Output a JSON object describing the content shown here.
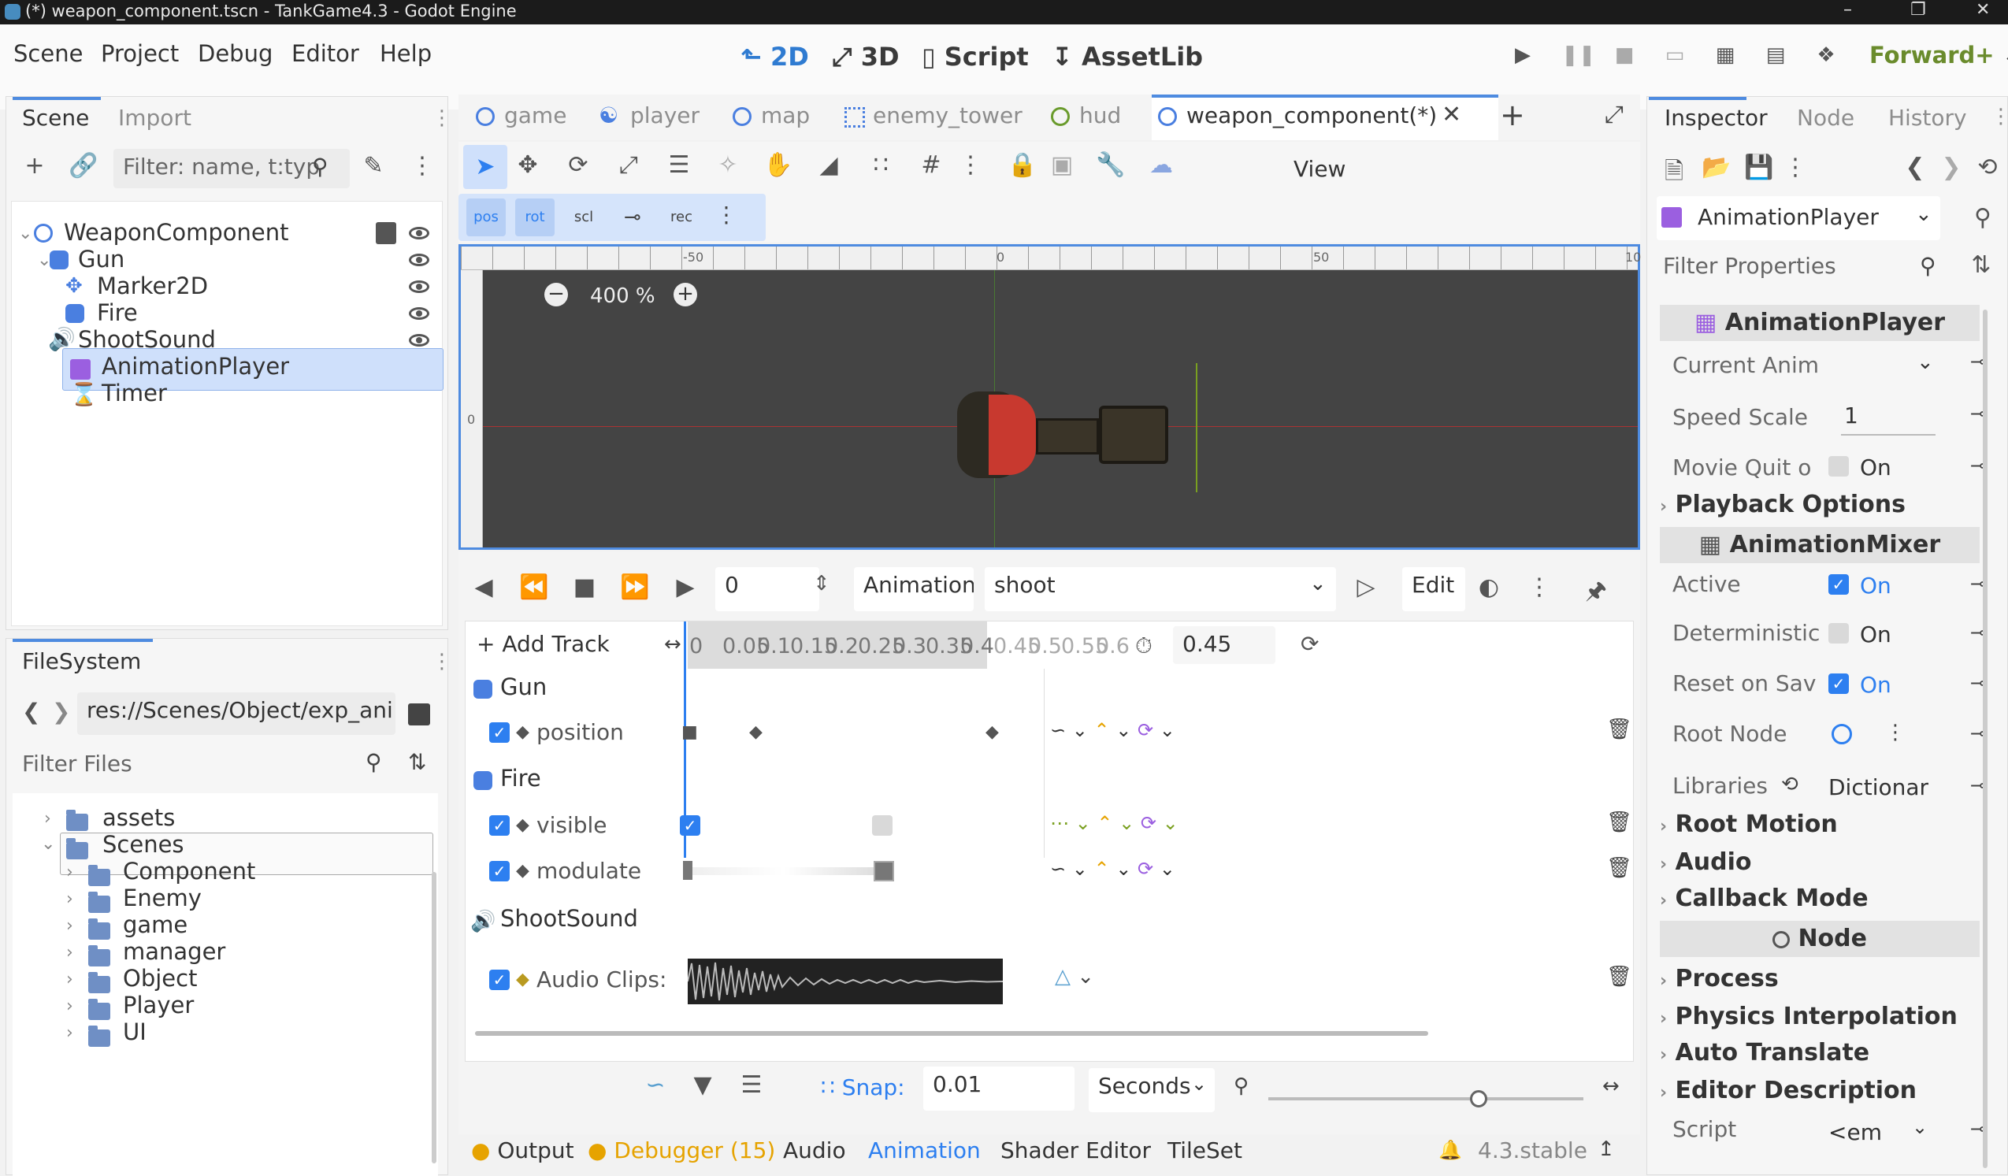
{
  "window": {
    "title": "(*) weapon_component.tscn - TankGame4.3 - Godot Engine"
  },
  "menu": [
    "Scene",
    "Project",
    "Debug",
    "Editor",
    "Help"
  ],
  "main_buttons": [
    "2D",
    "3D",
    "Script",
    "AssetLib"
  ],
  "renderer": "Forward+",
  "scene_dock": {
    "tabs": [
      "Scene",
      "Import"
    ],
    "filter_placeholder": "Filter: name, t:typ",
    "tree": [
      "WeaponComponent",
      "Gun",
      "Marker2D",
      "Fire",
      "ShootSound",
      "AnimationPlayer",
      "Timer"
    ]
  },
  "filesystem": {
    "tab": "FileSystem",
    "path": "res://Scenes/Object/exp_ani",
    "filter_placeholder": "Filter Files",
    "items": [
      "assets",
      "Scenes",
      "Component",
      "Enemy",
      "game",
      "manager",
      "Object",
      "Player",
      "UI"
    ]
  },
  "editor_tabs": [
    "game",
    "player",
    "map",
    "enemy_tower",
    "hud",
    "weapon_component(*)"
  ],
  "viewport": {
    "view_label": "View",
    "zoom": "400 %",
    "ruler": [
      "-50",
      "0",
      "50",
      "10"
    ],
    "ruler_left": "0"
  },
  "animation": {
    "time": "0",
    "animation_label": "Animation",
    "current": "shoot",
    "edit_label": "Edit",
    "add_track": "Add Track",
    "length": "0.45",
    "timeline_ticks": [
      "0",
      "0.05",
      "0.1",
      "0.15",
      "0.2",
      "0.25",
      "0.3",
      "0.35",
      "0.4",
      "0.45",
      "0.5",
      "0.55",
      "0.6"
    ],
    "tracks": [
      {
        "node": "Gun",
        "property": "position"
      },
      {
        "node": "Fire",
        "property": "visible"
      },
      {
        "node": "Fire",
        "property": "modulate"
      },
      {
        "node": "ShootSound",
        "property": "Audio Clips:"
      }
    ],
    "snap_label": "Snap:",
    "snap_value": "0.01",
    "snap_unit": "Seconds"
  },
  "bottom_bar": {
    "output": "Output",
    "debugger": "Debugger (15)",
    "audio": "Audio",
    "animation": "Animation",
    "shader": "Shader Editor",
    "tileset": "TileSet",
    "version": "4.3.stable"
  },
  "inspector": {
    "tabs": [
      "Inspector",
      "Node",
      "History"
    ],
    "object": "AnimationPlayer",
    "filter_placeholder": "Filter Properties",
    "header1": "AnimationPlayer",
    "current_anim": "Current Anim",
    "speed_scale": "Speed Scale",
    "speed_value": "1",
    "movie_quit": "Movie Quit o",
    "on": "On",
    "playback": "Playback Options",
    "header2": "AnimationMixer",
    "active": "Active",
    "deterministic": "Deterministic",
    "reset_on_save": "Reset on Sav",
    "root_node": "Root Node",
    "libraries": "Libraries",
    "libraries_value": "Dictionar",
    "root_motion": "Root Motion",
    "audio": "Audio",
    "callback_mode": "Callback Mode",
    "header3": "Node",
    "process": "Process",
    "physics_interp": "Physics Interpolation",
    "auto_translate": "Auto Translate",
    "editor_desc": "Editor Description",
    "script": "Script",
    "script_value": "<em"
  }
}
